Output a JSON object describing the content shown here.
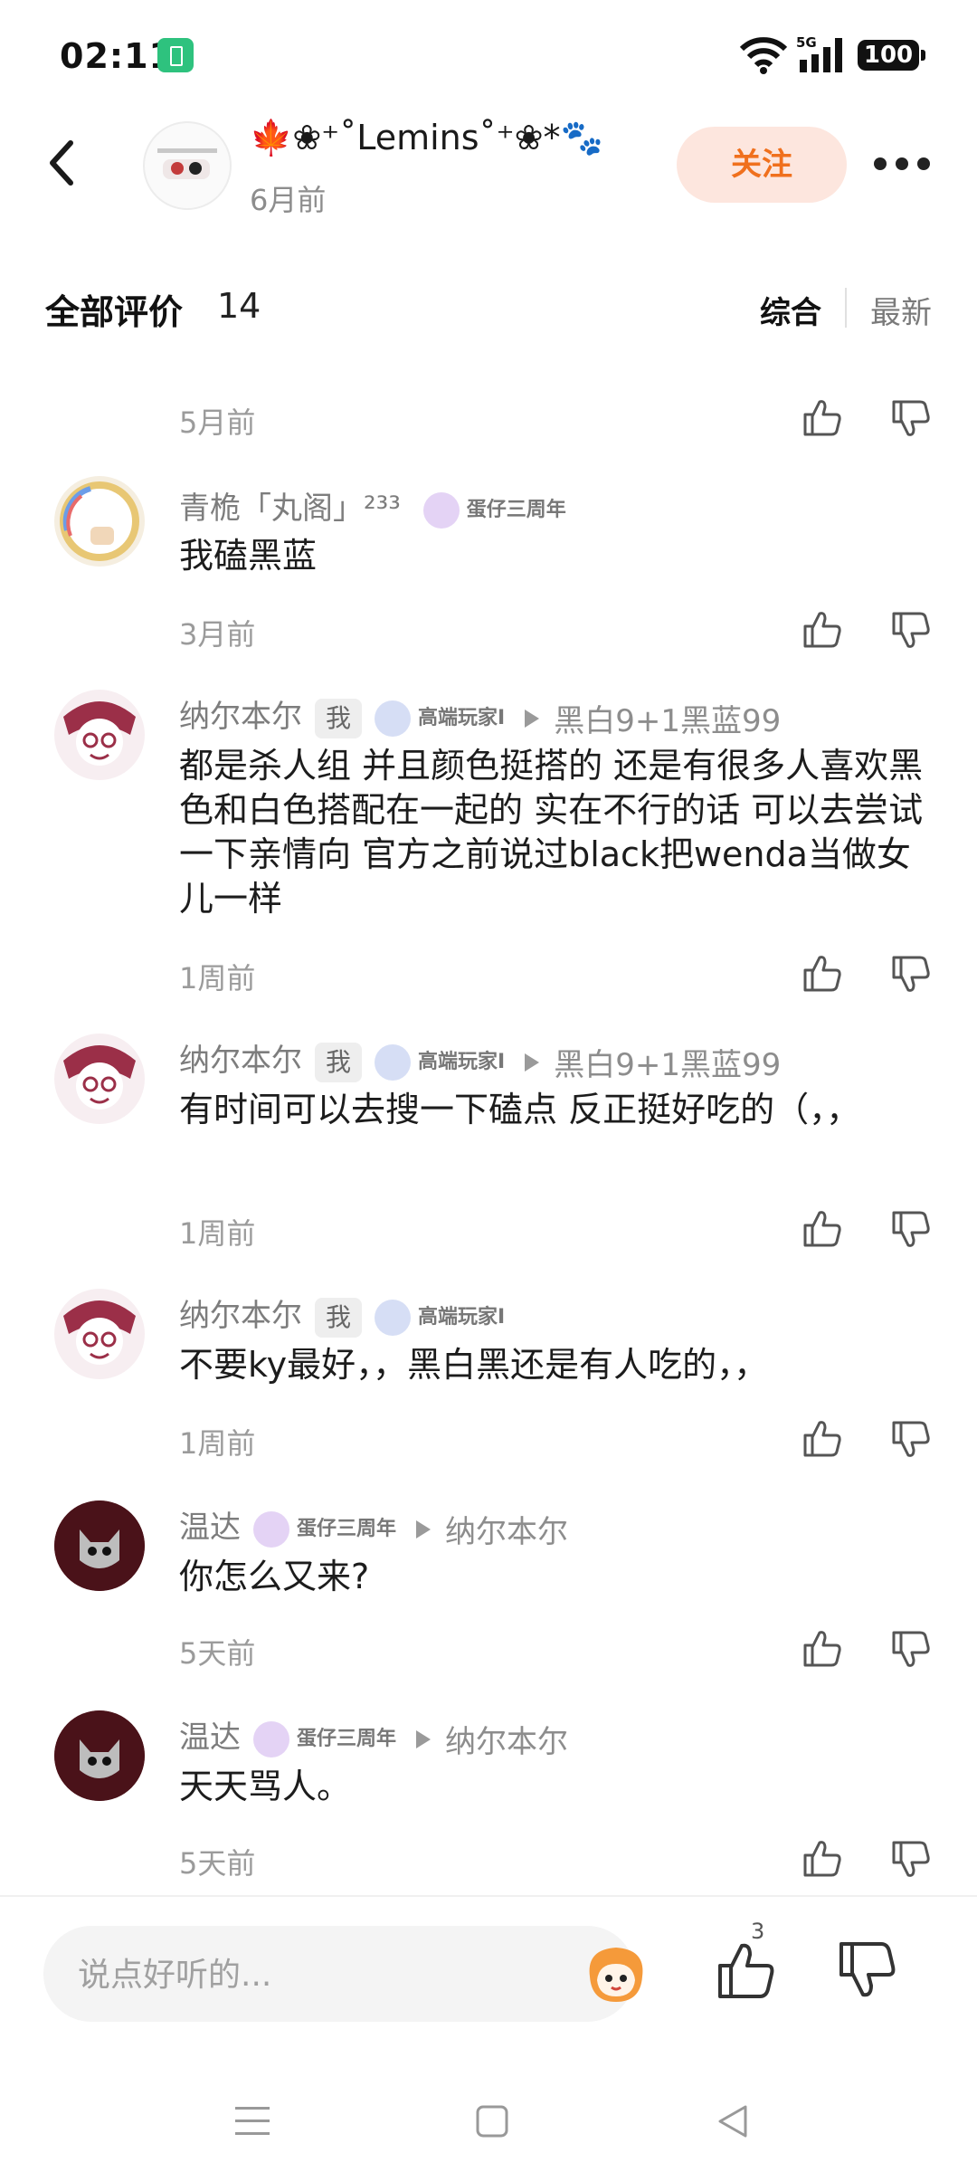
{
  "status_bar": {
    "time": "02:11",
    "network": "5G",
    "battery": "100"
  },
  "header": {
    "author_name": "🍁❀⁺˚Lemins˚⁺❀*🐾",
    "author_time": "6月前",
    "follow_label": "关注"
  },
  "reviews": {
    "title": "全部评价",
    "count": "14",
    "sort_hot": "综合",
    "sort_new": "最新"
  },
  "first_time": "5月前",
  "comments": [
    {
      "name": "青桅「丸阁」²³³",
      "me": "",
      "medal": "蛋仔三周年",
      "reply_to": "",
      "text": "我磕黑蓝",
      "time": "3月前"
    },
    {
      "name": "纳尔本尔",
      "me": "我",
      "medal": "高端玩家I",
      "reply_to": "黑白9+1黑蓝99",
      "text": "都是杀人组 并且颜色挺搭的 还是有很多人喜欢黑色和白色搭配在一起的 实在不行的话 可以去尝试一下亲情向 官方之前说过black把wenda当做女儿一样",
      "time": "1周前"
    },
    {
      "name": "纳尔本尔",
      "me": "我",
      "medal": "高端玩家I",
      "reply_to": "黑白9+1黑蓝99",
      "text": "有时间可以去搜一下磕点 反正挺好吃的（，，",
      "time": "1周前"
    },
    {
      "name": "纳尔本尔",
      "me": "我",
      "medal": "高端玩家I",
      "reply_to": "",
      "text": "不要ky最好，，黑白黑还是有人吃的，，",
      "time": "1周前"
    },
    {
      "name": "温达",
      "me": "",
      "medal": "蛋仔三周年",
      "reply_to": "纳尔本尔",
      "text": "你怎么又来?",
      "time": "5天前"
    },
    {
      "name": "温达",
      "me": "",
      "medal": "蛋仔三周年",
      "reply_to": "纳尔本尔",
      "text": "天天骂人。",
      "time": "5天前"
    }
  ],
  "bottom_bar": {
    "input_placeholder": "说点好听的...",
    "like_count": "3"
  },
  "icons": [
    "back-icon",
    "more-icon",
    "like-icon",
    "dislike-icon",
    "emoji-mascot-icon",
    "menu-nav-icon",
    "home-nav-icon",
    "back-nav-icon"
  ],
  "colors": {
    "accent": "#f0701d",
    "follow_bg": "#fde6de",
    "muted_text": "#8d8d8d"
  }
}
